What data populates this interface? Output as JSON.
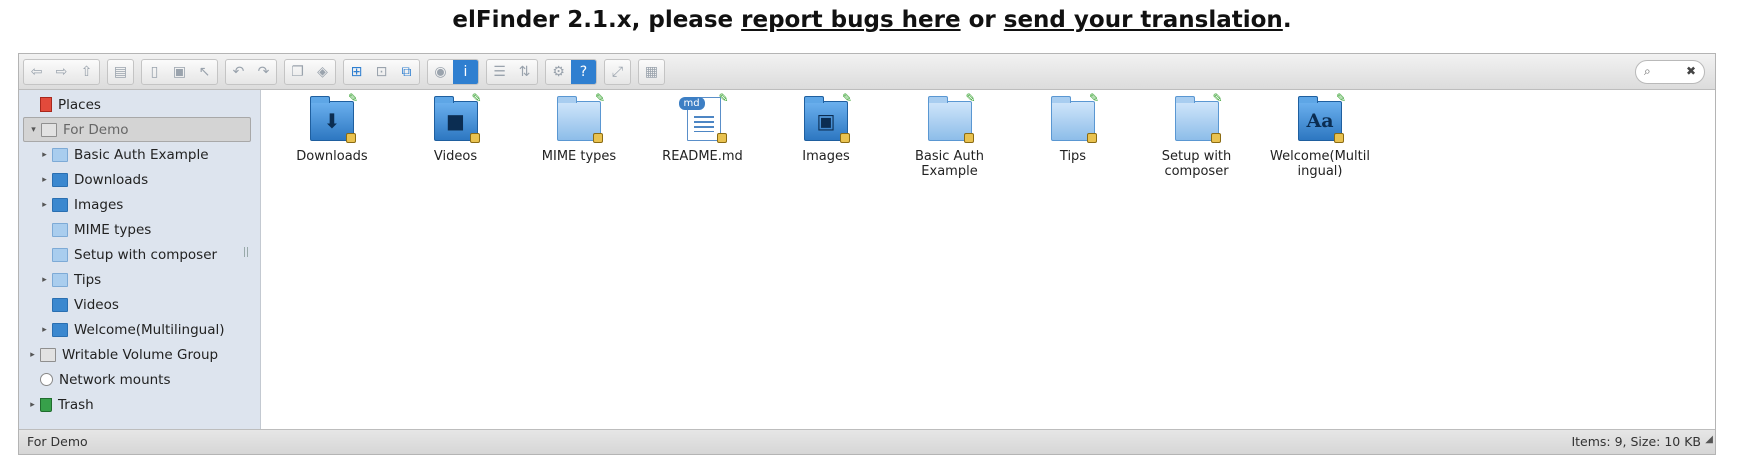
{
  "heading": {
    "prefix": "elFinder 2.1.x, please ",
    "link1": "report bugs here",
    "middle": " or ",
    "link2": "send your translation",
    "suffix": "."
  },
  "toolbar": {
    "groups": [
      [
        {
          "icon": "back-icon",
          "glyph": "⇦"
        },
        {
          "icon": "forward-icon",
          "glyph": "⇨"
        },
        {
          "icon": "up-icon",
          "glyph": "⇧"
        }
      ],
      [
        {
          "icon": "home-icon",
          "glyph": "▤"
        }
      ],
      [
        {
          "icon": "open-icon",
          "glyph": "▯"
        },
        {
          "icon": "save-icon",
          "glyph": "▣"
        },
        {
          "icon": "select-icon",
          "glyph": "↖"
        }
      ],
      [
        {
          "icon": "undo-icon",
          "glyph": "↶"
        },
        {
          "icon": "redo-icon",
          "glyph": "↷"
        }
      ],
      [
        {
          "icon": "copy-icon",
          "glyph": "❐"
        },
        {
          "icon": "paste-icon",
          "glyph": "◈"
        }
      ],
      [
        {
          "icon": "icons-view-icon",
          "glyph": "⊞",
          "state": "blue"
        },
        {
          "icon": "grid-icon",
          "glyph": "⊡"
        },
        {
          "icon": "select-all-icon",
          "glyph": "⧉",
          "state": "blue"
        }
      ],
      [
        {
          "icon": "preview-icon",
          "glyph": "◉"
        },
        {
          "icon": "info-icon",
          "glyph": "i",
          "state": "sel"
        }
      ],
      [
        {
          "icon": "list-view-icon",
          "glyph": "☰"
        },
        {
          "icon": "sort-icon",
          "glyph": "⇅"
        }
      ],
      [
        {
          "icon": "settings-icon",
          "glyph": "⚙"
        },
        {
          "icon": "help-icon",
          "glyph": "?",
          "state": "sel"
        }
      ],
      [
        {
          "icon": "fullscreen-icon",
          "glyph": "⤢"
        }
      ],
      [
        {
          "icon": "preferences-icon",
          "glyph": "▦"
        }
      ]
    ]
  },
  "search": {
    "icon": "search-icon",
    "glyph": "⌕",
    "clear": "✖"
  },
  "navbar": {
    "items": [
      {
        "label": "Places",
        "icon": "places",
        "arrow": "",
        "indent": 0
      },
      {
        "label": "For Demo",
        "icon": "drive",
        "arrow": "▾",
        "indent": 0,
        "selected": true
      },
      {
        "label": "Basic Auth Example",
        "icon": "folder",
        "arrow": "▸",
        "indent": 1
      },
      {
        "label": "Downloads",
        "icon": "folder-dark",
        "arrow": "▸",
        "indent": 1
      },
      {
        "label": "Images",
        "icon": "folder-dark",
        "arrow": "▸",
        "indent": 1
      },
      {
        "label": "MIME types",
        "icon": "folder",
        "arrow": "",
        "indent": 1
      },
      {
        "label": "Setup with composer",
        "icon": "folder",
        "arrow": "",
        "indent": 1
      },
      {
        "label": "Tips",
        "icon": "folder",
        "arrow": "▸",
        "indent": 1
      },
      {
        "label": "Videos",
        "icon": "folder-dark",
        "arrow": "",
        "indent": 1
      },
      {
        "label": "Welcome(Multilingual)",
        "icon": "folder-dark",
        "arrow": "▸",
        "indent": 1
      },
      {
        "label": "Writable Volume Group",
        "icon": "drive",
        "arrow": "▸",
        "indent": 0
      },
      {
        "label": "Network mounts",
        "icon": "net",
        "arrow": "",
        "indent": 0
      },
      {
        "label": "Trash",
        "icon": "trash",
        "arrow": "▸",
        "indent": 0
      }
    ]
  },
  "files": [
    {
      "name": "Downloads",
      "type": "folder-dark",
      "glyph": "⬇"
    },
    {
      "name": "Videos",
      "type": "folder-dark",
      "glyph": "■"
    },
    {
      "name": "MIME types",
      "type": "folder",
      "glyph": ""
    },
    {
      "name": "README.md",
      "type": "doc",
      "badge": "md"
    },
    {
      "name": "Images",
      "type": "folder-dark",
      "glyph": "▣"
    },
    {
      "name": "Basic Auth Example",
      "type": "folder",
      "glyph": ""
    },
    {
      "name": "Tips",
      "type": "folder",
      "glyph": ""
    },
    {
      "name": "Setup with composer",
      "type": "folder",
      "glyph": ""
    },
    {
      "name": "Welcome(Multilingual)",
      "type": "folder-dark",
      "glyph": "Aa"
    }
  ],
  "status": {
    "path": "For Demo",
    "summary": "Items: 9, Size: 10 KB"
  }
}
